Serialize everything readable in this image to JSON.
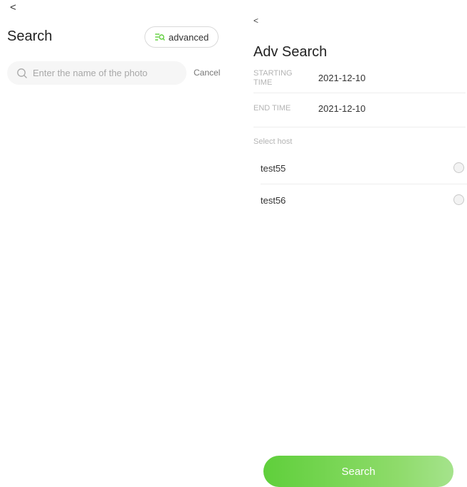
{
  "left": {
    "back_glyph": "<",
    "title": "Search",
    "advanced_label": "advanced",
    "search_placeholder": "Enter the name of the photo",
    "search_value": "",
    "cancel_label": "Cancel"
  },
  "right": {
    "back_glyph": "<",
    "title": "Adv Search",
    "start_time": {
      "label": "STARTING TIME",
      "value": "2021-12-10"
    },
    "end_time": {
      "label": "END TIME",
      "value": "2021-12-10"
    },
    "hosts_label": "Select host",
    "hosts": [
      {
        "name": "test55",
        "selected": false
      },
      {
        "name": "test56",
        "selected": false
      }
    ],
    "submit_label": "Search"
  },
  "colors": {
    "accent_green": "#5fcf3b",
    "accent_green_light": "#a5e38c",
    "muted_text": "#b4b4b4"
  },
  "icons": {
    "back": "chevron-left-icon",
    "advanced": "filter-search-icon",
    "search": "search-icon",
    "radio": "radio-icon"
  }
}
